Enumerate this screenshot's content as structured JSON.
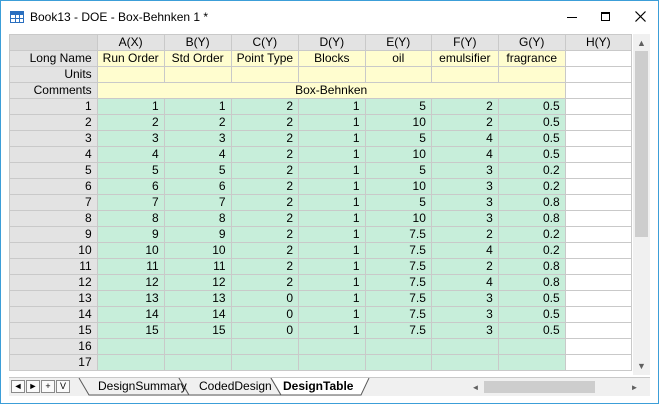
{
  "window": {
    "title": "Book13 - DOE - Box-Behnken 1 *",
    "controls": [
      "minimize",
      "maximize",
      "close"
    ]
  },
  "sheet": {
    "columns": [
      {
        "header": "A(X)",
        "long_name": "Run Order"
      },
      {
        "header": "B(Y)",
        "long_name": "Std Order"
      },
      {
        "header": "C(Y)",
        "long_name": "Point Type"
      },
      {
        "header": "D(Y)",
        "long_name": "Blocks"
      },
      {
        "header": "E(Y)",
        "long_name": "oil"
      },
      {
        "header": "F(Y)",
        "long_name": "emulsifier"
      },
      {
        "header": "G(Y)",
        "long_name": "fragrance"
      },
      {
        "header": "H(Y)",
        "long_name": ""
      }
    ],
    "meta_rows": {
      "long_name": "Long Name",
      "units": "Units",
      "comments": "Comments"
    },
    "comments_value": "Box-Behnken",
    "rows": [
      {
        "n": "1",
        "cells": [
          "1",
          "1",
          "2",
          "1",
          "5",
          "2",
          "0.5"
        ]
      },
      {
        "n": "2",
        "cells": [
          "2",
          "2",
          "2",
          "1",
          "10",
          "2",
          "0.5"
        ]
      },
      {
        "n": "3",
        "cells": [
          "3",
          "3",
          "2",
          "1",
          "5",
          "4",
          "0.5"
        ]
      },
      {
        "n": "4",
        "cells": [
          "4",
          "4",
          "2",
          "1",
          "10",
          "4",
          "0.5"
        ]
      },
      {
        "n": "5",
        "cells": [
          "5",
          "5",
          "2",
          "1",
          "5",
          "3",
          "0.2"
        ]
      },
      {
        "n": "6",
        "cells": [
          "6",
          "6",
          "2",
          "1",
          "10",
          "3",
          "0.2"
        ]
      },
      {
        "n": "7",
        "cells": [
          "7",
          "7",
          "2",
          "1",
          "5",
          "3",
          "0.8"
        ]
      },
      {
        "n": "8",
        "cells": [
          "8",
          "8",
          "2",
          "1",
          "10",
          "3",
          "0.8"
        ]
      },
      {
        "n": "9",
        "cells": [
          "9",
          "9",
          "2",
          "1",
          "7.5",
          "2",
          "0.2"
        ]
      },
      {
        "n": "10",
        "cells": [
          "10",
          "10",
          "2",
          "1",
          "7.5",
          "4",
          "0.2"
        ]
      },
      {
        "n": "11",
        "cells": [
          "11",
          "11",
          "2",
          "1",
          "7.5",
          "2",
          "0.8"
        ]
      },
      {
        "n": "12",
        "cells": [
          "12",
          "12",
          "2",
          "1",
          "7.5",
          "4",
          "0.8"
        ]
      },
      {
        "n": "13",
        "cells": [
          "13",
          "13",
          "0",
          "1",
          "7.5",
          "3",
          "0.5"
        ]
      },
      {
        "n": "14",
        "cells": [
          "14",
          "14",
          "0",
          "1",
          "7.5",
          "3",
          "0.5"
        ]
      },
      {
        "n": "15",
        "cells": [
          "15",
          "15",
          "0",
          "1",
          "7.5",
          "3",
          "0.5"
        ]
      },
      {
        "n": "16",
        "cells": [
          "",
          "",
          "",
          "",
          "",
          "",
          ""
        ]
      },
      {
        "n": "17",
        "cells": [
          "",
          "",
          "",
          "",
          "",
          "",
          ""
        ]
      }
    ]
  },
  "navigation": {
    "buttons": [
      "◄",
      "►",
      "+",
      "V"
    ]
  },
  "tabs": [
    {
      "label": "DesignSummary",
      "active": false
    },
    {
      "label": "CodedDesign",
      "active": false
    },
    {
      "label": "DesignTable",
      "active": true
    }
  ],
  "colors": {
    "data_cell": "#c7eeda",
    "meta_cell": "#fffdcf",
    "header_cell": "#e3e3e3",
    "window_border": "#3c9ed8"
  }
}
